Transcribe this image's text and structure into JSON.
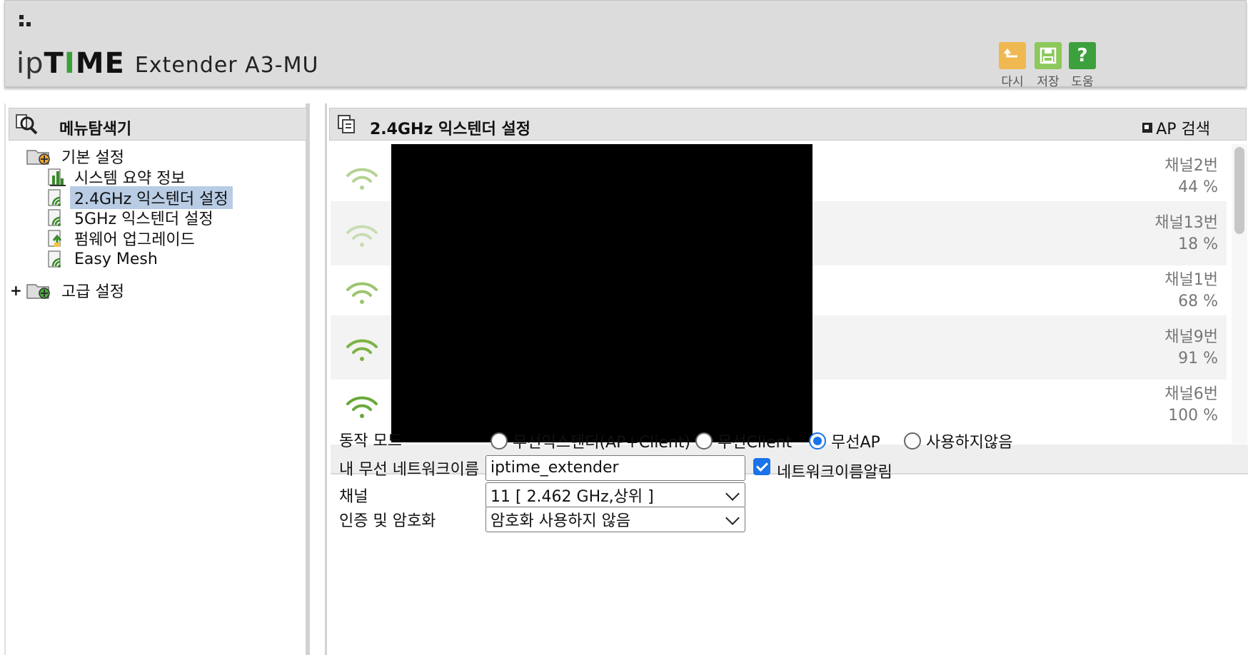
{
  "header": {
    "brand_ip": "ip",
    "brand_time_t": "T",
    "brand_time_i": "I",
    "brand_time_me": "ME",
    "model": "Extender A3-MU",
    "buttons": [
      {
        "label": "다시",
        "icon": "undo-icon",
        "color": "#f0b850"
      },
      {
        "label": "저장",
        "icon": "save-icon",
        "color": "#8cc85a"
      },
      {
        "label": "도움",
        "icon": "help-icon",
        "color": "#3ca03c",
        "glyph": "?"
      }
    ]
  },
  "sidebar": {
    "title": "메뉴탐색기",
    "tree": [
      {
        "label": "기본 설정",
        "icon": "folder-settings-icon"
      },
      {
        "label": "시스템 요약 정보",
        "icon": "chart-icon"
      },
      {
        "label": "2.4GHz 익스텐더 설정",
        "icon": "wireless-doc-icon",
        "selected": true
      },
      {
        "label": "5GHz 익스텐더 설정",
        "icon": "wireless-doc-icon"
      },
      {
        "label": "펌웨어 업그레이드",
        "icon": "upgrade-doc-icon"
      },
      {
        "label": "Easy Mesh",
        "icon": "wireless-doc-icon"
      },
      {
        "label": "고급 설정",
        "icon": "folder-advanced-icon",
        "expander": "+"
      }
    ]
  },
  "main": {
    "title": "2.4GHz 익스텐더 설정",
    "ap_search": "AP 검색",
    "ap_list": [
      {
        "channel": "채널2번",
        "signal": "44 %",
        "strength": 0.44
      },
      {
        "channel": "채널13번",
        "signal": "18 %",
        "strength": 0.18
      },
      {
        "channel": "채널1번",
        "signal": "68 %",
        "strength": 0.68
      },
      {
        "channel": "채널9번",
        "signal": "91 %",
        "strength": 0.91
      },
      {
        "channel": "채널6번",
        "signal": "100 %",
        "strength": 1.0
      }
    ],
    "form": {
      "mode_label": "동작 모드",
      "mode_options": [
        "무선익스텐더(AP+Client)",
        "무선Client",
        "무선AP",
        "사용하지않음"
      ],
      "mode_selected": "무선AP",
      "ssid_label": "내 무선 네트워크이름",
      "ssid_value": "iptime_extender",
      "broadcast_label": "네트워크이름알림",
      "broadcast_checked": true,
      "channel_label": "채널",
      "channel_value": "11 [ 2.462 GHz,상위 ]",
      "auth_label": "인증 및 암호화",
      "auth_value": "암호화 사용하지 않음"
    }
  },
  "colors": {
    "accent": "#1a73e8",
    "wifi_green": "#7cb342",
    "selected_bg": "#b8cce4"
  }
}
